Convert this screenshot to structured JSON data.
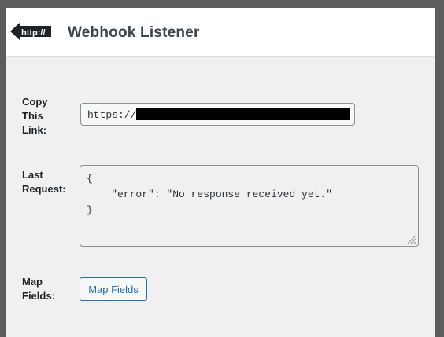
{
  "header": {
    "logo_text": "http://",
    "title": "Webhook Listener"
  },
  "form": {
    "link": {
      "label_lines": [
        "Copy",
        "This",
        "Link:"
      ],
      "value_prefix": "https://"
    },
    "last_request": {
      "label_lines": [
        "Last",
        "Request:"
      ],
      "value": "{\n    \"error\": \"No response received yet.\"\n}"
    },
    "map_fields": {
      "label_lines": [
        "Map",
        "Fields:"
      ],
      "button_label": "Map Fields"
    }
  },
  "icons": {
    "logo": "http-back-arrow-icon",
    "resize": "resize-grip-icon"
  },
  "colors": {
    "accent": "#2271b1",
    "header_bg": "#ffffff",
    "panel_bg": "#f0f0f1",
    "backdrop": "#5d5d5d",
    "title": "#3c434a"
  }
}
